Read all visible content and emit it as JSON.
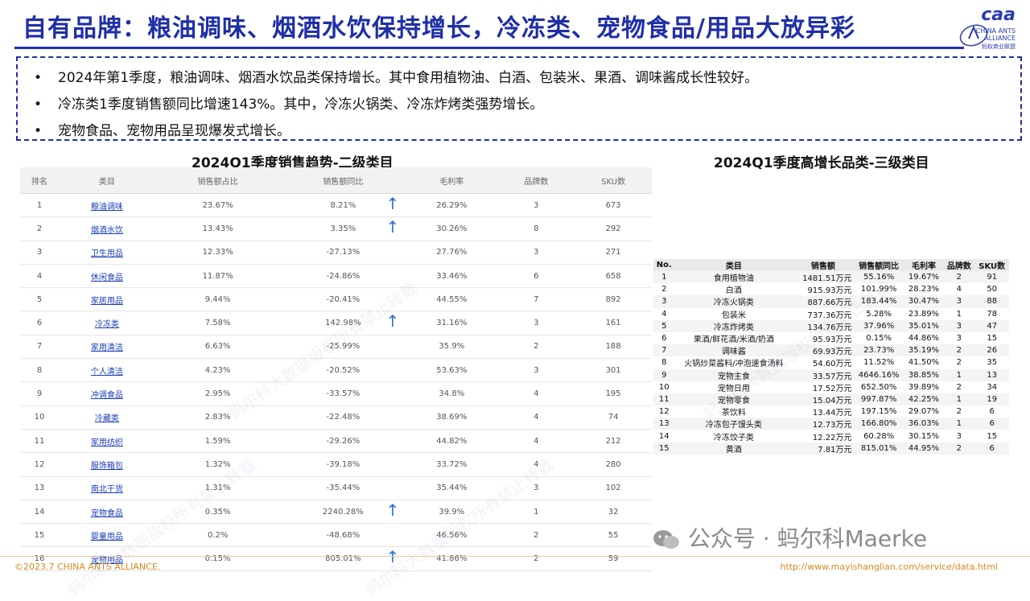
{
  "title": "自有品牌：粮油调味、烟酒水饮保持增长，冷冻类、宠物食品/用品大放异彩",
  "logo": {
    "brand": "caa",
    "line1": "CHINA ANTS",
    "line2": "ALLIANCE",
    "line3": "蚂蚁商业联盟"
  },
  "bullets": [
    "2024年第1季度，粮油调味、烟酒水饮品类保持增长。其中食用植物油、白酒、包装米、果酒、调味酱成长性较好。",
    "冷冻类1季度销售额同比增速143%。其中，冷冻火锅类、冷冻炸烤类强势增长。",
    "宠物食品、宠物用品呈现爆发式增长。"
  ],
  "bullet_marker": "•",
  "left_title": "2024Q1季度销售趋势-二级类目",
  "right_title": "2024Q1季度高增长品类-三级类目",
  "left_table": {
    "headers": [
      "排名",
      "类目",
      "销售额占比",
      "销售额同比",
      "毛利率",
      "品牌数",
      "SKU数"
    ],
    "rows": [
      [
        "1",
        "粮油调味",
        "23.67%",
        "8.21%",
        "26.29%",
        "3",
        "673"
      ],
      [
        "2",
        "烟酒水饮",
        "13.43%",
        "3.35%",
        "30.26%",
        "8",
        "292"
      ],
      [
        "3",
        "卫生用品",
        "12.33%",
        "-27.13%",
        "27.76%",
        "3",
        "271"
      ],
      [
        "4",
        "休闲食品",
        "11.87%",
        "-24.86%",
        "33.46%",
        "6",
        "658"
      ],
      [
        "5",
        "家居用品",
        "9.44%",
        "-20.41%",
        "44.55%",
        "7",
        "892"
      ],
      [
        "6",
        "冷冻类",
        "7.58%",
        "142.98%",
        "31.16%",
        "3",
        "161"
      ],
      [
        "7",
        "家用清洁",
        "6.63%",
        "-25.99%",
        "35.9%",
        "2",
        "188"
      ],
      [
        "8",
        "个人清洁",
        "4.23%",
        "-20.52%",
        "53.63%",
        "3",
        "301"
      ],
      [
        "9",
        "冲调食品",
        "2.95%",
        "-33.57%",
        "34.8%",
        "4",
        "195"
      ],
      [
        "10",
        "冷藏类",
        "2.83%",
        "-22.48%",
        "38.69%",
        "4",
        "74"
      ],
      [
        "11",
        "家用纺织",
        "1.59%",
        "-29.26%",
        "44.82%",
        "4",
        "212"
      ],
      [
        "12",
        "服饰箱包",
        "1.32%",
        "-39.18%",
        "33.72%",
        "4",
        "280"
      ],
      [
        "13",
        "南北干货",
        "1.31%",
        "-35.44%",
        "35.44%",
        "3",
        "102"
      ],
      [
        "14",
        "宠物食品",
        "0.35%",
        "2240.28%",
        "39.9%",
        "1",
        "32"
      ],
      [
        "15",
        "婴童用品",
        "0.2%",
        "-48.68%",
        "46.56%",
        "2",
        "55"
      ],
      [
        "16",
        "宠物用品",
        "0.15%",
        "805.01%",
        "41.86%",
        "2",
        "59"
      ]
    ],
    "up_arrow": "↑"
  },
  "right_table": {
    "headers": [
      "No.",
      "类目",
      "销售额",
      "销售额同比",
      "毛利率",
      "品牌数",
      "SKU数"
    ],
    "rows": [
      [
        "1",
        "食用植物油",
        "1481.51万元",
        "55.16%",
        "19.67%",
        "2",
        "91"
      ],
      [
        "2",
        "白酒",
        "915.93万元",
        "101.99%",
        "28.23%",
        "4",
        "50"
      ],
      [
        "3",
        "冷冻火锅类",
        "887.66万元",
        "183.44%",
        "30.47%",
        "3",
        "88"
      ],
      [
        "4",
        "包装米",
        "737.36万元",
        "5.28%",
        "23.89%",
        "1",
        "78"
      ],
      [
        "5",
        "冷冻炸烤类",
        "134.76万元",
        "37.96%",
        "35.01%",
        "3",
        "47"
      ],
      [
        "6",
        "果酒/鲜花酒/米酒/奶酒",
        "95.93万元",
        "0.15%",
        "44.86%",
        "3",
        "15"
      ],
      [
        "7",
        "调味酱",
        "69.93万元",
        "23.73%",
        "35.19%",
        "2",
        "26"
      ],
      [
        "8",
        "火锅炒菜酱料/冲泡速食汤料",
        "54.60万元",
        "11.52%",
        "41.50%",
        "2",
        "35"
      ],
      [
        "9",
        "宠物主食",
        "33.57万元",
        "4646.16%",
        "38.85%",
        "1",
        "13"
      ],
      [
        "10",
        "宠物日用",
        "17.52万元",
        "652.50%",
        "39.89%",
        "2",
        "34"
      ],
      [
        "11",
        "宠物零食",
        "15.04万元",
        "997.87%",
        "42.25%",
        "1",
        "19"
      ],
      [
        "12",
        "茶饮料",
        "13.44万元",
        "197.15%",
        "29.07%",
        "2",
        "6"
      ],
      [
        "13",
        "冷冻包子馒头类",
        "12.73万元",
        "166.80%",
        "36.03%",
        "1",
        "6"
      ],
      [
        "14",
        "冷冻饺子类",
        "12.22万元",
        "60.28%",
        "30.15%",
        "3",
        "15"
      ],
      [
        "15",
        "黄酒",
        "7.81万元",
        "815.01%",
        "44.95%",
        "2",
        "6"
      ]
    ]
  },
  "footer_left": "©2023.7 CHINA ANTS ALLIANCE.",
  "footer_right": "http://www.mayishanglian.com/service/data.html",
  "wechat_text": "公众号 · 蚂尔科Maerke",
  "watermark": "蚂尔科大数据版权所有禁止转载",
  "colors": {
    "title_blue": "#1f2fa8",
    "link_blue": "#1a3db8",
    "arrow_blue": "#2a6fd6",
    "footer_orange": "#d98a1e"
  },
  "icons": [
    "up-arrow-icon",
    "wechat-icon",
    "logo-icon"
  ]
}
